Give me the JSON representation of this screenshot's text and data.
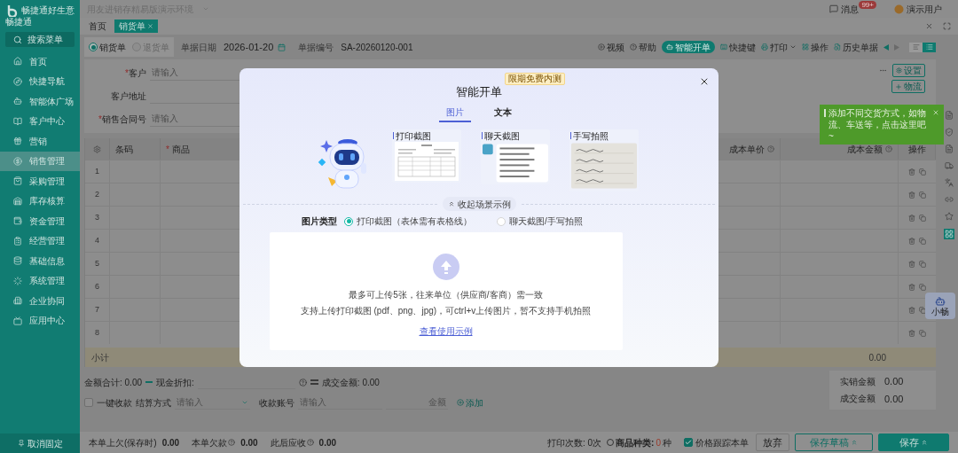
{
  "brand": {
    "name": "畅捷通好生意",
    "caption": "畅捷通"
  },
  "top_bar": {
    "account": "用友进销存精易版演示环境",
    "messages": "消息",
    "message_badge": "99+",
    "user": "演示用户"
  },
  "page_tabs": [
    {
      "label": "首页",
      "selected": false,
      "closable": false
    },
    {
      "label": "销货单",
      "selected": true,
      "closable": true
    }
  ],
  "sidebar": {
    "search": "搜索菜单",
    "footer": "取消固定",
    "items": [
      {
        "label": "首页",
        "selected": false
      },
      {
        "label": "快捷导航",
        "selected": false
      },
      {
        "label": "智能体广场",
        "selected": false
      },
      {
        "label": "客户中心",
        "selected": false
      },
      {
        "label": "营销",
        "selected": false
      },
      {
        "label": "销售管理",
        "selected": true
      },
      {
        "label": "采购管理",
        "selected": false
      },
      {
        "label": "库存核算",
        "selected": false
      },
      {
        "label": "资金管理",
        "selected": false
      },
      {
        "label": "经营管理",
        "selected": false
      },
      {
        "label": "基础信息",
        "selected": false
      },
      {
        "label": "系统管理",
        "selected": false
      },
      {
        "label": "企业协同",
        "selected": false
      },
      {
        "label": "应用中心",
        "selected": false
      }
    ]
  },
  "doc_types": [
    {
      "label": "销货单",
      "selected": true
    },
    {
      "label": "退货单",
      "selected": false
    }
  ],
  "doc_date": {
    "label": "单据日期",
    "value": "2026-01-20"
  },
  "doc_number": {
    "label": "单据编号",
    "value": "SA-20260120-001"
  },
  "toolbar": [
    {
      "label": "视频",
      "highlighted": false,
      "has_menu": false
    },
    {
      "label": "帮助",
      "highlighted": false,
      "has_menu": false
    },
    {
      "label": "智能开单",
      "highlighted": true,
      "has_menu": false
    },
    {
      "label": "快捷键",
      "highlighted": false,
      "has_menu": false
    },
    {
      "label": "打印",
      "highlighted": false,
      "has_menu": true
    },
    {
      "label": "操作",
      "highlighted": false,
      "has_menu": false
    },
    {
      "label": "历史单据",
      "highlighted": false,
      "has_menu": false
    }
  ],
  "view_toggle": [
    {
      "selected": false
    },
    {
      "selected": true
    }
  ],
  "form": [
    {
      "label": "客户",
      "required_mark": "*",
      "placeholder": "请输入"
    },
    {
      "label": "客户地址"
    },
    {
      "label": "销售合同号",
      "required_mark": "*",
      "placeholder": "请输入"
    }
  ],
  "side_buttons": [
    {
      "label": "设置"
    },
    {
      "label": "物流"
    }
  ],
  "toast": {
    "text": "添加不同交货方式，如物流、车送等，点击这里吧~"
  },
  "table": {
    "columns": [
      {
        "label": "条码"
      },
      {
        "label": "商品",
        "required_mark": "*"
      },
      {
        "label": "成本单价",
        "help": true
      },
      {
        "label": "成本金额",
        "help": true
      },
      {
        "label": "操作"
      }
    ],
    "rows": [
      {
        "index": "1"
      },
      {
        "index": "2"
      },
      {
        "index": "3"
      },
      {
        "index": "4"
      },
      {
        "index": "5"
      },
      {
        "index": "6"
      },
      {
        "index": "7"
      },
      {
        "index": "8"
      }
    ],
    "subtotal": {
      "label": "小计",
      "cost_amount": "0.00"
    }
  },
  "summary": {
    "total_label": "金额合计:",
    "total": "0.00",
    "discount_label": "现金折扣:",
    "deal_label": "成交金额:",
    "deal": "0.00",
    "quick_collect": {
      "label": "一键收款",
      "checked": false
    },
    "settle_label": "结算方式",
    "settle_placeholder": "请输入",
    "account_label": "收款账号",
    "account_placeholder": "请输入",
    "amount_placeholder": "金额",
    "add": "添加",
    "box": [
      {
        "label": "实销金额",
        "value": "0.00"
      },
      {
        "label": "成交金额",
        "value": "0.00"
      }
    ]
  },
  "footer": {
    "stats": [
      {
        "label": "本单上欠(保存时)",
        "value": "0.00",
        "help": false
      },
      {
        "label": "本单欠款",
        "value": "0.00",
        "help": true
      },
      {
        "label": "此后应收",
        "value": "0.00",
        "help": true
      }
    ],
    "print_count": "打印次数: 0次",
    "kinds_label": "商品种类:",
    "kinds_value": "0",
    "kinds_unit": "种",
    "price_track": {
      "label": "价格跟踪本单",
      "checked": true
    },
    "buttons": [
      {
        "label": "放弃",
        "kind": "plain"
      },
      {
        "label": "保存草稿",
        "kind": "outline"
      },
      {
        "label": "保存",
        "kind": "primary"
      }
    ]
  },
  "assistant": {
    "label": "小畅"
  },
  "modal": {
    "title": "智能开单",
    "badge": "限期免费内测",
    "tabs": [
      {
        "label": "图片",
        "selected": true
      },
      {
        "label": "文本",
        "selected": false
      }
    ],
    "examples": [
      {
        "title": "打印截图",
        "kind": "print"
      },
      {
        "title": "聊天截图",
        "kind": "chat"
      },
      {
        "title": "手写拍照",
        "kind": "handwriting"
      }
    ],
    "collapse": "收起场景示例",
    "type_label": "图片类型",
    "types": [
      {
        "label": "打印截图（表体需有表格线）",
        "selected": true
      },
      {
        "label": "聊天截图/手写拍照",
        "selected": false
      }
    ],
    "hints": [
      "最多可上传5张，往来单位（供应商/客商）需一致",
      "支持上传打印截图 (pdf、png、jpg)，可ctrl+v上传图片，暂不支持手机拍照"
    ],
    "link": "查看使用示例"
  }
}
